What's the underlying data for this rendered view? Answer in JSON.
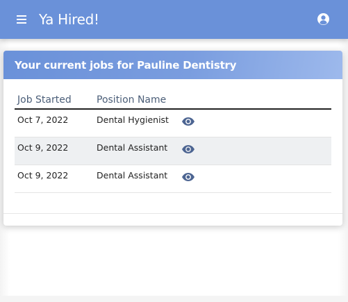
{
  "app": {
    "title": "Ya Hired!",
    "menu_icon": "hamburger-menu-icon",
    "account_icon": "user-circle-icon",
    "brand_color": "#6a91d9"
  },
  "card": {
    "title": "Your current jobs for Pauline Dentistry",
    "columns": [
      "Job Started",
      "Position Name"
    ],
    "rows": [
      {
        "date": "Oct 7, 2022",
        "position": "Dental Hygienist",
        "action_icon": "eye-icon"
      },
      {
        "date": "Oct 9, 2022",
        "position": "Dental Assistant",
        "action_icon": "eye-icon"
      },
      {
        "date": "Oct 9, 2022",
        "position": "Dental Assistant",
        "action_icon": "eye-icon"
      }
    ]
  }
}
